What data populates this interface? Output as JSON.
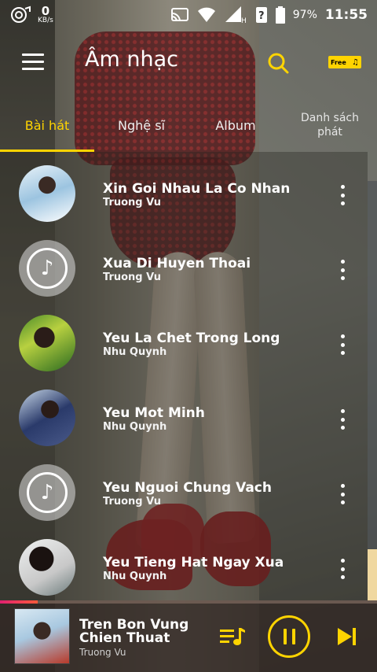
{
  "status_bar": {
    "net_speed": "0",
    "net_unit": "KB/s",
    "battery": "97%",
    "time": "11:55"
  },
  "header": {
    "title": "Âm nhạc",
    "free_badge": "Free"
  },
  "tabs": [
    {
      "label": "Bài hát",
      "active": true
    },
    {
      "label": "Nghệ sĩ",
      "active": false
    },
    {
      "label": "Album",
      "active": false
    },
    {
      "label": "Danh sách phát",
      "active": false
    }
  ],
  "songs": [
    {
      "title": "Xin Goi Nhau La Co Nhan",
      "artist": "Truong Vu",
      "art": "cover"
    },
    {
      "title": "Xua Di Huyen Thoai",
      "artist": "Truong Vu",
      "art": "default"
    },
    {
      "title": "Yeu La Chet Trong Long",
      "artist": "Nhu Quynh",
      "art": "cover"
    },
    {
      "title": "Yeu Mot Minh",
      "artist": "Nhu Quynh",
      "art": "cover"
    },
    {
      "title": "Yeu Nguoi Chung Vach",
      "artist": "Truong Vu",
      "art": "default"
    },
    {
      "title": "Yeu Tieng Hat Ngay Xua",
      "artist": "Nhu Quynh",
      "art": "cover"
    }
  ],
  "player": {
    "title": "Tren Bon Vung Chien Thuat",
    "artist": "Truong Vu",
    "progress": 0.1,
    "accent_color": "#ffd400"
  }
}
